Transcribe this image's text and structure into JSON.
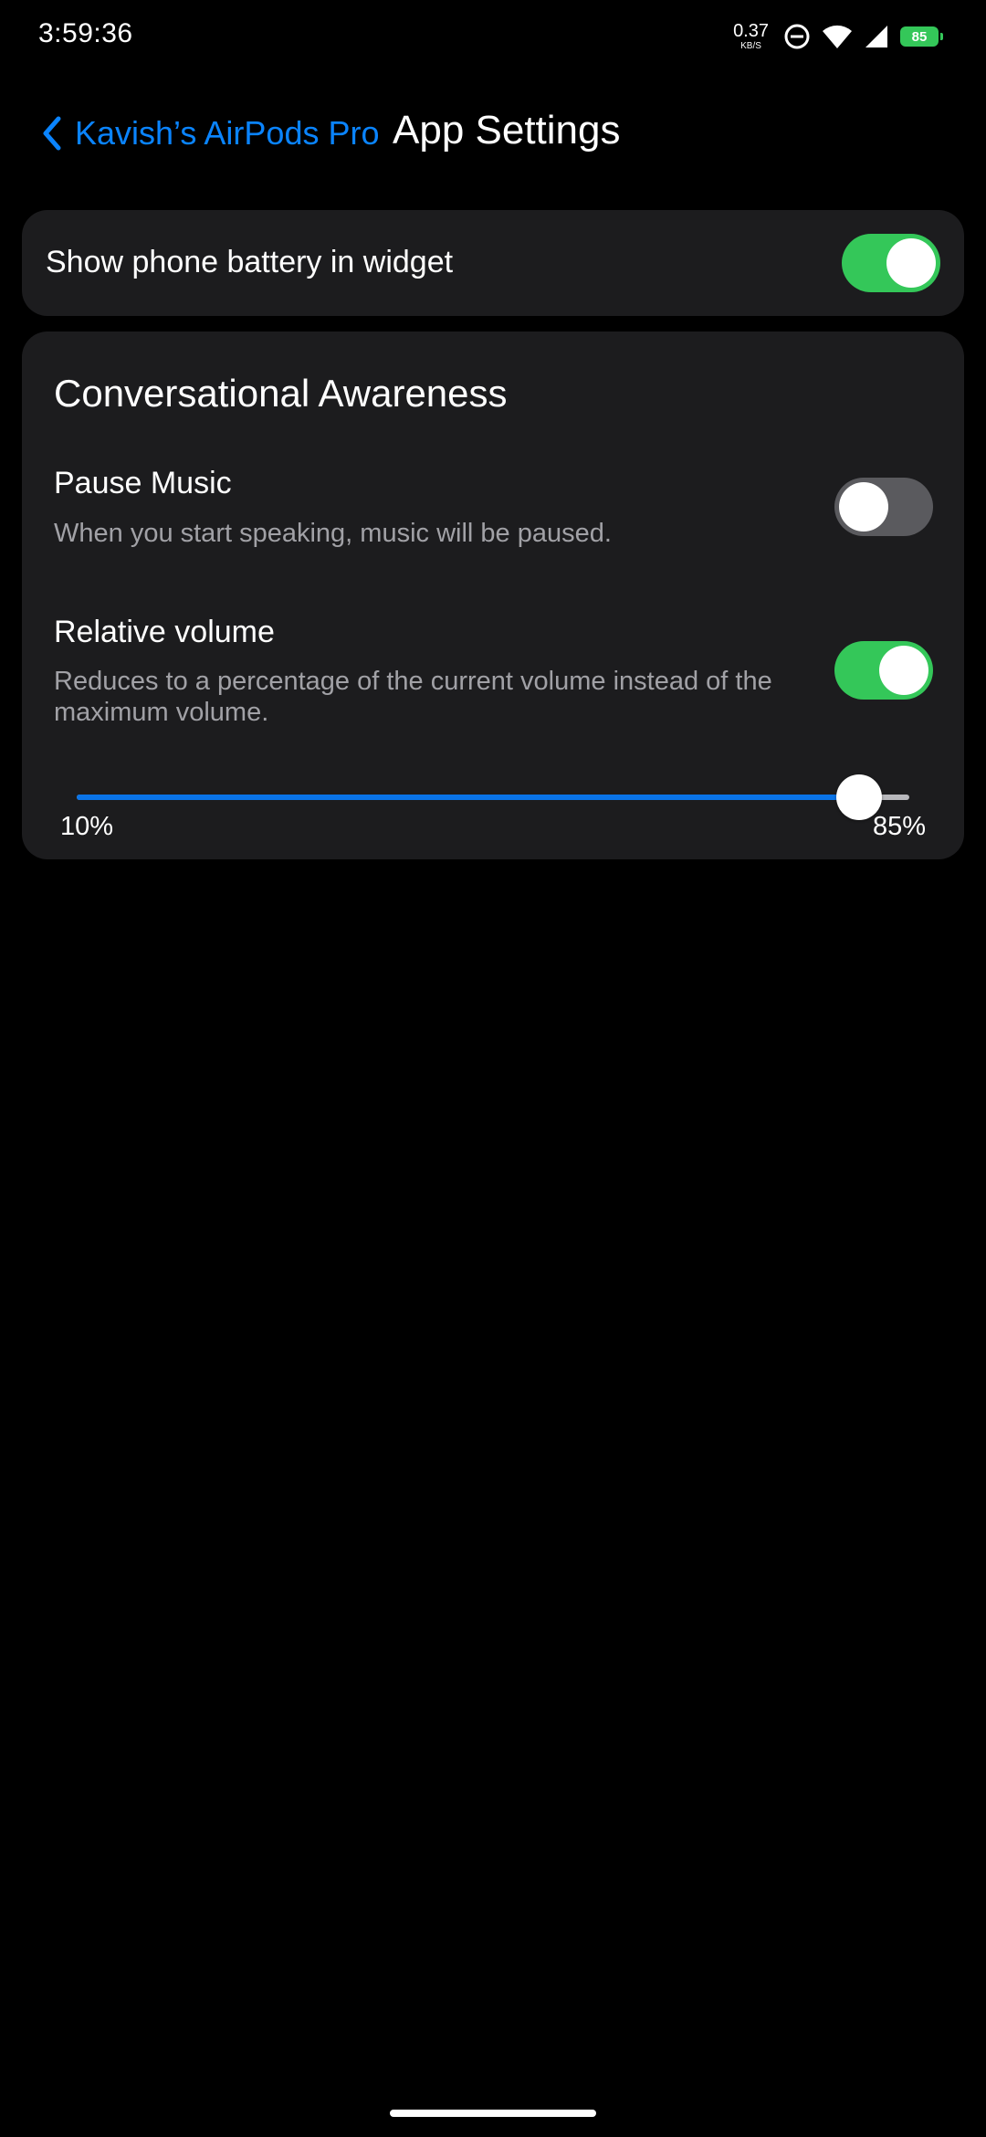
{
  "status_bar": {
    "time": "3:59:36",
    "net_speed": "0.37",
    "net_unit": "KB/S",
    "battery": "85",
    "icons": [
      "dnd-icon",
      "wifi-icon",
      "cell-signal-icon",
      "battery-icon"
    ]
  },
  "header": {
    "back_label": "Kavish’s AirPods Pro",
    "title": "App Settings"
  },
  "battery_widget": {
    "label": "Show phone battery in widget",
    "enabled": true
  },
  "conversational_awareness": {
    "title": "Conversational Awareness",
    "pause_music": {
      "label": "Pause Music",
      "description": "When you start speaking, music will be paused.",
      "enabled": false
    },
    "relative_volume": {
      "label": "Relative volume",
      "description": "Reduces to a percentage of the current volume instead of the maximum volume.",
      "enabled": true
    },
    "volume_slider": {
      "min_label": "10%",
      "max_label": "85%",
      "min": 10,
      "max": 85,
      "value": 0.94
    }
  },
  "colors": {
    "accent_blue": "#0a84ff",
    "toggle_on": "#34c759",
    "toggle_off": "#5a5a5e",
    "card_bg": "#1c1c1e",
    "slider_fill": "#0a74e8"
  }
}
